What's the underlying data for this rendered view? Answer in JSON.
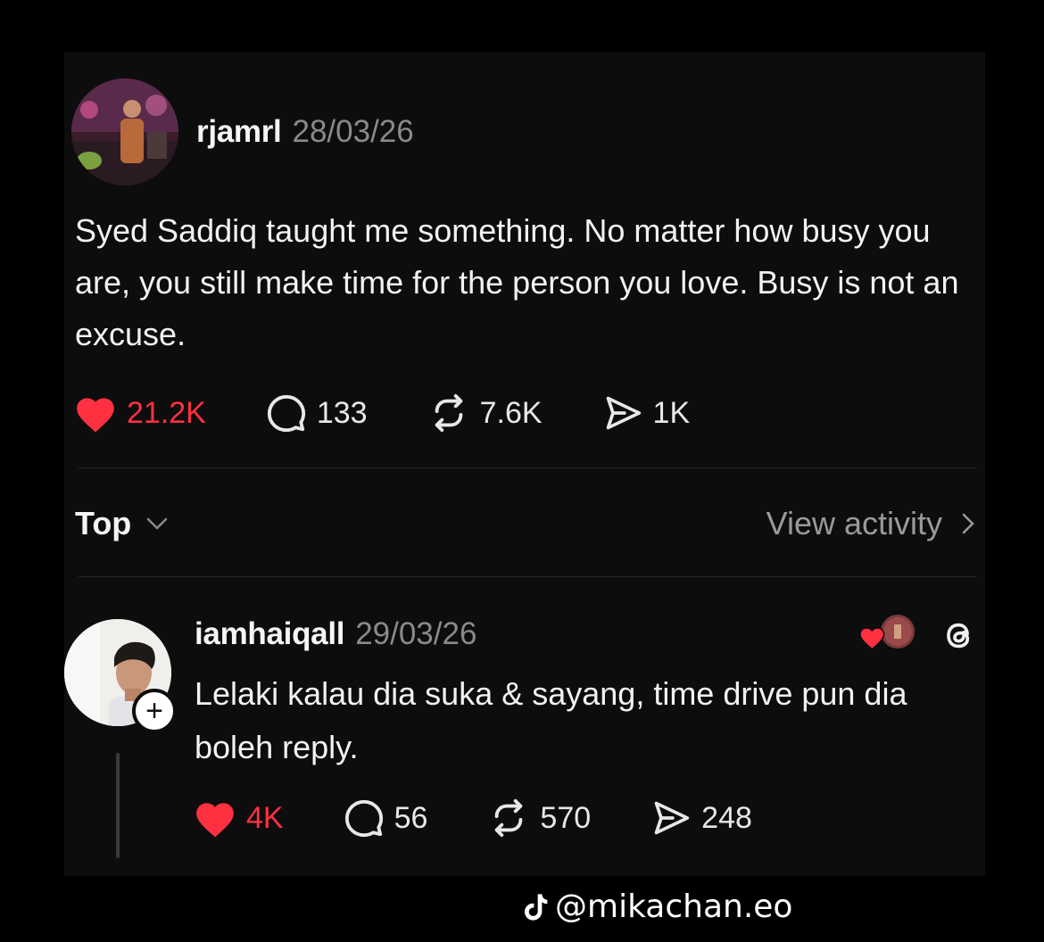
{
  "post": {
    "username": "rjamrl",
    "date": "28/03/26",
    "text": "Syed Saddiq taught me something. No matter how busy you are, you still make time for the person you love. Busy is not an excuse.",
    "likes": "21.2K",
    "comments": "133",
    "reposts": "7.6K",
    "shares": "1K"
  },
  "sort": {
    "label": "Top",
    "view_activity": "View activity"
  },
  "reply": {
    "username": "iamhaiqall",
    "date": "29/03/26",
    "text": "Lelaki kalau dia suka & sayang, time drive pun dia boleh reply.",
    "likes": "4K",
    "comments": "56",
    "reposts": "570",
    "shares": "248"
  },
  "watermark": {
    "handle": "@mikachan.eo"
  },
  "colors": {
    "background": "#000000",
    "card": "#0d0d0d",
    "like_red": "#ff3040",
    "muted": "#8a8a8a"
  },
  "icons": {
    "like": "heart-icon",
    "comment": "comment-bubble-icon",
    "repost": "repost-icon",
    "share": "share-send-icon",
    "threads": "threads-logo-icon",
    "watermark": "tiktok-icon"
  }
}
